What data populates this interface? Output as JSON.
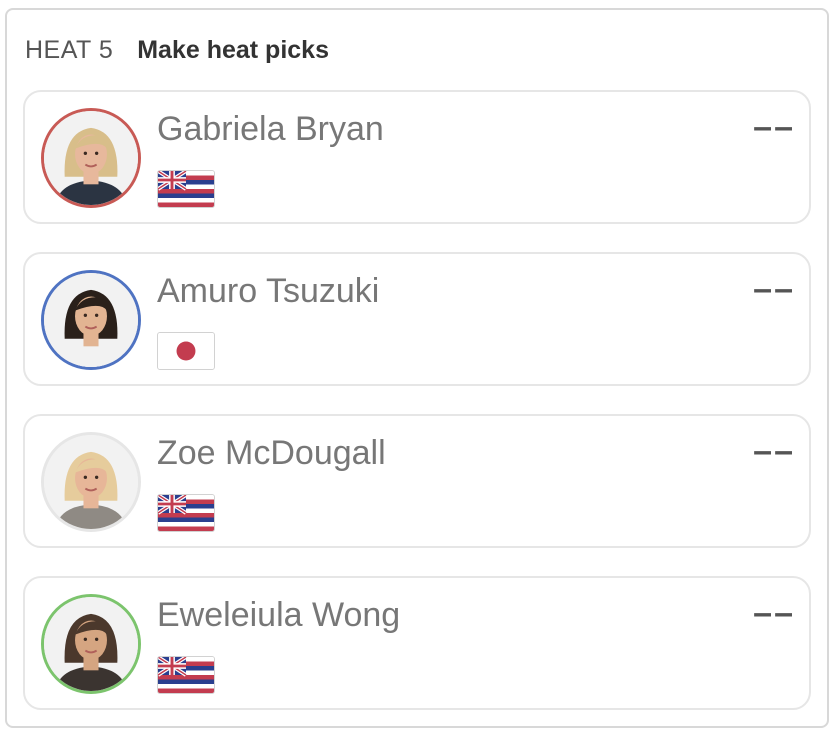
{
  "header": {
    "heat_label": "HEAT 5",
    "title": "Make heat picks"
  },
  "surfers": [
    {
      "name": "Gabriela Bryan",
      "pick": "––",
      "flag": "hawaii-flag",
      "ring_color": "#c85a55",
      "hair": "#d8be8a",
      "skin": "#e7b89c",
      "shirt": "#2b3442"
    },
    {
      "name": "Amuro Tsuzuki",
      "pick": "––",
      "flag": "japan-flag",
      "ring_color": "#4f73c2",
      "hair": "#2a201a",
      "skin": "#e2b492",
      "shirt": "#f2f2f2"
    },
    {
      "name": "Zoe McDougall",
      "pick": "––",
      "flag": "hawaii-flag",
      "ring_color": "#e6e6e6",
      "hair": "#e6cc9c",
      "skin": "#e7b698",
      "shirt": "#8f8a84"
    },
    {
      "name": "Eweleiula Wong",
      "pick": "––",
      "flag": "hawaii-flag",
      "ring_color": "#7cc46d",
      "hair": "#4b382c",
      "skin": "#d5a581",
      "shirt": "#3b3430"
    }
  ],
  "colors": {
    "japan_red": "#c33c4f",
    "hawaii_red": "#c33c4f",
    "hawaii_blue": "#2a3f8f"
  }
}
